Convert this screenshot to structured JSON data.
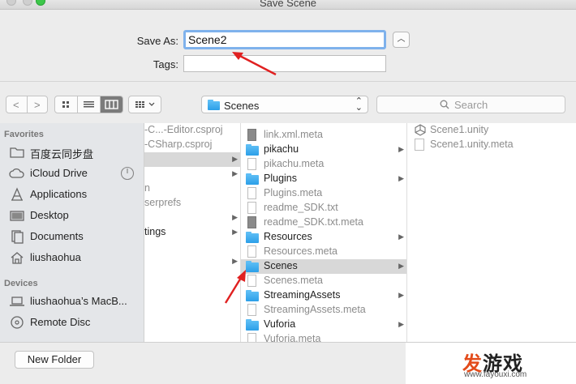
{
  "window": {
    "title": "Save Scene"
  },
  "save": {
    "label": "Save As:",
    "value": "Scene2",
    "tags_label": "Tags:",
    "tags_value": ""
  },
  "toolbar": {
    "path": "Scenes",
    "search_placeholder": "Search"
  },
  "sidebar": {
    "favorites_header": "Favorites",
    "favorites": [
      "百度云同步盘",
      "iCloud Drive",
      "Applications",
      "Desktop",
      "Documents",
      "liushaohua"
    ],
    "devices_header": "Devices",
    "devices": [
      "liushaohua’s MacB...",
      "Remote Disc"
    ]
  },
  "col1": [
    "-C...-Editor.csproj",
    "-CSharp.csproj",
    "",
    "",
    "n",
    "serprefs",
    "",
    "tings",
    ""
  ],
  "col2": [
    {
      "name": "link.xml.meta",
      "kind": "doc-dk"
    },
    {
      "name": "pikachu",
      "kind": "folder"
    },
    {
      "name": "pikachu.meta",
      "kind": "doc"
    },
    {
      "name": "Plugins",
      "kind": "folder"
    },
    {
      "name": "Plugins.meta",
      "kind": "doc"
    },
    {
      "name": "readme_SDK.txt",
      "kind": "doc"
    },
    {
      "name": "readme_SDK.txt.meta",
      "kind": "doc-dk"
    },
    {
      "name": "Resources",
      "kind": "folder"
    },
    {
      "name": "Resources.meta",
      "kind": "doc"
    },
    {
      "name": "Scenes",
      "kind": "folder"
    },
    {
      "name": "Scenes.meta",
      "kind": "doc"
    },
    {
      "name": "StreamingAssets",
      "kind": "folder"
    },
    {
      "name": "StreamingAssets.meta",
      "kind": "doc"
    },
    {
      "name": "Vuforia",
      "kind": "folder"
    },
    {
      "name": "Vuforia.meta",
      "kind": "doc"
    }
  ],
  "col3": [
    "Scene1.unity",
    "Scene1.unity.meta"
  ],
  "footer": {
    "new_folder": "New Folder"
  },
  "watermark": {
    "logo_a": "发",
    "logo_b": "游戏",
    "url": "www.fayouxi.com"
  }
}
